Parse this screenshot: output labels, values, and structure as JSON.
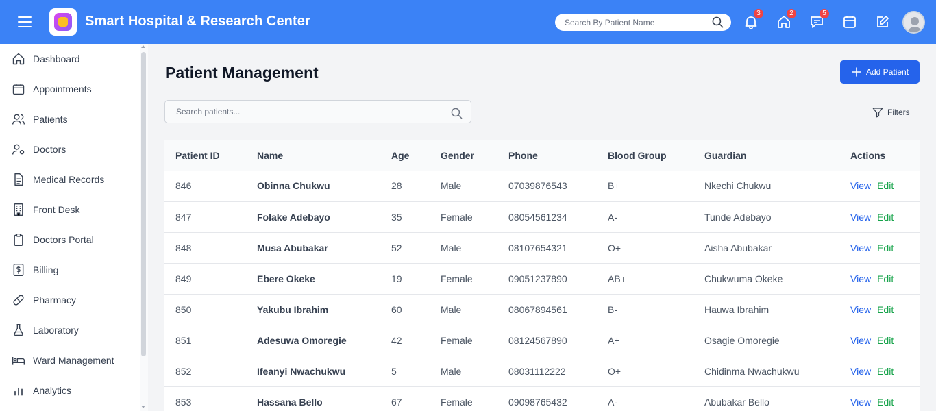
{
  "app": {
    "title": "Smart Hospital & Research Center",
    "brand_color": "#3b82f6"
  },
  "topbar": {
    "search_placeholder": "Search By Patient Name",
    "notifications_count": "3",
    "home_count": "2",
    "messages_count": "5",
    "avatar_alt": "User"
  },
  "sidebar": {
    "items": [
      {
        "label": "Dashboard",
        "icon": "home-icon"
      },
      {
        "label": "Appointments",
        "icon": "calendar-icon"
      },
      {
        "label": "Patients",
        "icon": "users-icon"
      },
      {
        "label": "Doctors",
        "icon": "user-cog-icon"
      },
      {
        "label": "Medical Records",
        "icon": "file-text-icon"
      },
      {
        "label": "Front Desk",
        "icon": "building-icon"
      },
      {
        "label": "Doctors Portal",
        "icon": "clipboard-icon"
      },
      {
        "label": "Billing",
        "icon": "dollar-icon"
      },
      {
        "label": "Pharmacy",
        "icon": "pill-icon"
      },
      {
        "label": "Laboratory",
        "icon": "flask-icon"
      },
      {
        "label": "Ward Management",
        "icon": "bed-icon"
      },
      {
        "label": "Analytics",
        "icon": "bar-chart-icon"
      }
    ]
  },
  "main": {
    "title": "Patient Management",
    "add_label": "Add Patient",
    "search_placeholder": "Search patients...",
    "filters_label": "Filters"
  },
  "table": {
    "columns": [
      "Patient ID",
      "Name",
      "Age",
      "Gender",
      "Phone",
      "Blood Group",
      "Guardian",
      "Actions"
    ],
    "view_label": "View",
    "edit_label": "Edit",
    "rows": [
      {
        "id": "846",
        "name": "Obinna Chukwu",
        "age": "28",
        "gender": "Male",
        "phone": "07039876543",
        "blood": "B+",
        "guardian": "Nkechi Chukwu"
      },
      {
        "id": "847",
        "name": "Folake Adebayo",
        "age": "35",
        "gender": "Female",
        "phone": "08054561234",
        "blood": "A-",
        "guardian": "Tunde Adebayo"
      },
      {
        "id": "848",
        "name": "Musa Abubakar",
        "age": "52",
        "gender": "Male",
        "phone": "08107654321",
        "blood": "O+",
        "guardian": "Aisha Abubakar"
      },
      {
        "id": "849",
        "name": "Ebere Okeke",
        "age": "19",
        "gender": "Female",
        "phone": "09051237890",
        "blood": "AB+",
        "guardian": "Chukwuma Okeke"
      },
      {
        "id": "850",
        "name": "Yakubu Ibrahim",
        "age": "60",
        "gender": "Male",
        "phone": "08067894561",
        "blood": "B-",
        "guardian": "Hauwa Ibrahim"
      },
      {
        "id": "851",
        "name": "Adesuwa Omoregie",
        "age": "42",
        "gender": "Female",
        "phone": "08124567890",
        "blood": "A+",
        "guardian": "Osagie Omoregie"
      },
      {
        "id": "852",
        "name": "Ifeanyi Nwachukwu",
        "age": "5",
        "gender": "Male",
        "phone": "08031112222",
        "blood": "O+",
        "guardian": "Chidinma Nwachukwu"
      },
      {
        "id": "853",
        "name": "Hassana Bello",
        "age": "67",
        "gender": "Female",
        "phone": "09098765432",
        "blood": "A-",
        "guardian": "Abubakar Bello"
      }
    ]
  }
}
